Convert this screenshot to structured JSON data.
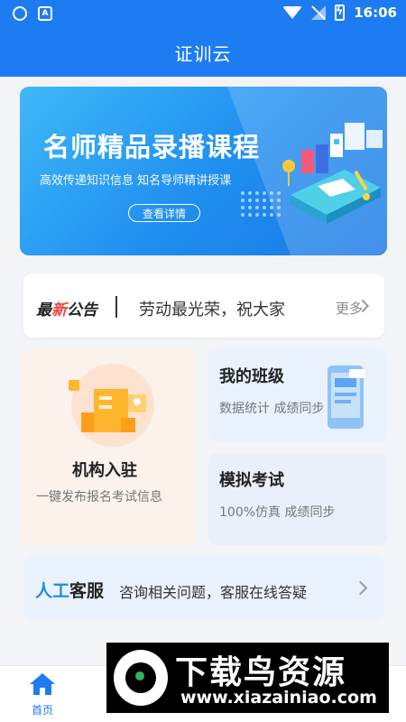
{
  "status_bar": {
    "time": "16:06",
    "left_icons": [
      "shield-icon",
      "a-icon"
    ],
    "left_a": "A",
    "right_icons": [
      "wifi-icon",
      "no-signal-icon",
      "battery-charging-icon"
    ]
  },
  "header": {
    "title": "证训云"
  },
  "banner": {
    "title": "名师精品录播课程",
    "subtitle": "高效传递知识信息 知名导师精讲授课",
    "button_label": "查看详情"
  },
  "notice": {
    "label_prefix": "最",
    "label_red": "新",
    "label_suffix": "公告",
    "text": "劳动最光荣，祝大家",
    "more_label": "更多"
  },
  "cards": {
    "org": {
      "title": "机构入驻",
      "subtitle": "一键发布报名考试信息"
    },
    "my_class": {
      "title": "我的班级",
      "subtitle": "数据统计 成绩同步"
    },
    "mock_exam": {
      "title": "模拟考试",
      "subtitle": "100%仿真 成绩同步"
    }
  },
  "service": {
    "label_blue": "人工",
    "label_rest": "客服",
    "text": "咨询相关问题，客服在线答疑"
  },
  "tabbar": {
    "home_label": "首页"
  },
  "watermark": {
    "main_text": "下载鸟资源",
    "url": "www.xiazainiao.com"
  },
  "colors": {
    "primary": "#1e7cf2",
    "notice_red": "#f0463c",
    "service_blue": "#1e8ae8",
    "org_bg": "#fbf2eb",
    "class_bg": "#e9f2fd"
  }
}
